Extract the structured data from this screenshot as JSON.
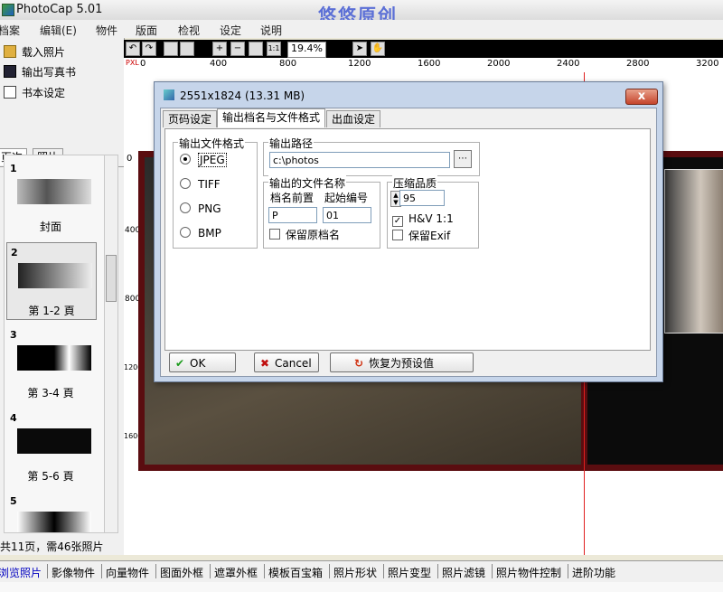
{
  "app": {
    "title": "PhotoCap 5.01",
    "watermark": "悠悠原创"
  },
  "menu": [
    "档案",
    "编辑(E)",
    "物件",
    "版面",
    "检视",
    "设定",
    "说明"
  ],
  "left": {
    "commands": [
      "载入照片",
      "输出写真书",
      "书本设定"
    ],
    "tabs": [
      "页次",
      "照片"
    ],
    "pages": [
      {
        "num": "1",
        "label": "封面"
      },
      {
        "num": "2",
        "label": "第 1-2 頁"
      },
      {
        "num": "3",
        "label": "第 3-4 頁"
      },
      {
        "num": "4",
        "label": "第 5-6 頁"
      },
      {
        "num": "5",
        "label": ""
      }
    ],
    "status": "共11页，需46张照片"
  },
  "toolbar": {
    "zoom": "19.4%"
  },
  "ruler": {
    "h": [
      "0",
      "400",
      "800",
      "1200",
      "1600",
      "2000",
      "2400",
      "2800",
      "3200"
    ],
    "v": [
      "0",
      "400",
      "800",
      "1200",
      "1600"
    ],
    "unit": "PXL"
  },
  "dialog": {
    "title": "2551x1824 (13.31 MB)",
    "close": "x",
    "tabs": [
      "页码设定",
      "输出档名与文件格式",
      "出血设定"
    ],
    "format_group": "输出文件格式",
    "formats": [
      "JPEG",
      "TIFF",
      "PNG",
      "BMP"
    ],
    "selected_format": "JPEG",
    "path_group": "输出路径",
    "path_value": "c:\\photos",
    "filename_group": "输出的文件名称",
    "prefix_label": "档名前置",
    "start_label": "起始编号",
    "prefix_value": "P",
    "start_value": "01",
    "keep_name": "保留原档名",
    "quality_group": "压缩品质",
    "quality_value": "95",
    "hv_label": "H&V 1:1",
    "exif_label": "保留Exif",
    "ok": "OK",
    "cancel": "Cancel",
    "reset": "恢复为预设值"
  },
  "bottom_tabs": [
    "浏览照片",
    "影像物件",
    "向量物件",
    "图面外框",
    "遮罩外框",
    "模板百宝箱",
    "照片形状",
    "照片变型",
    "照片滤镜",
    "照片物件控制",
    "进阶功能"
  ],
  "colors": {
    "accent": "#5b6fd6",
    "spread": "#5a0d10",
    "guide": "#e02020"
  }
}
